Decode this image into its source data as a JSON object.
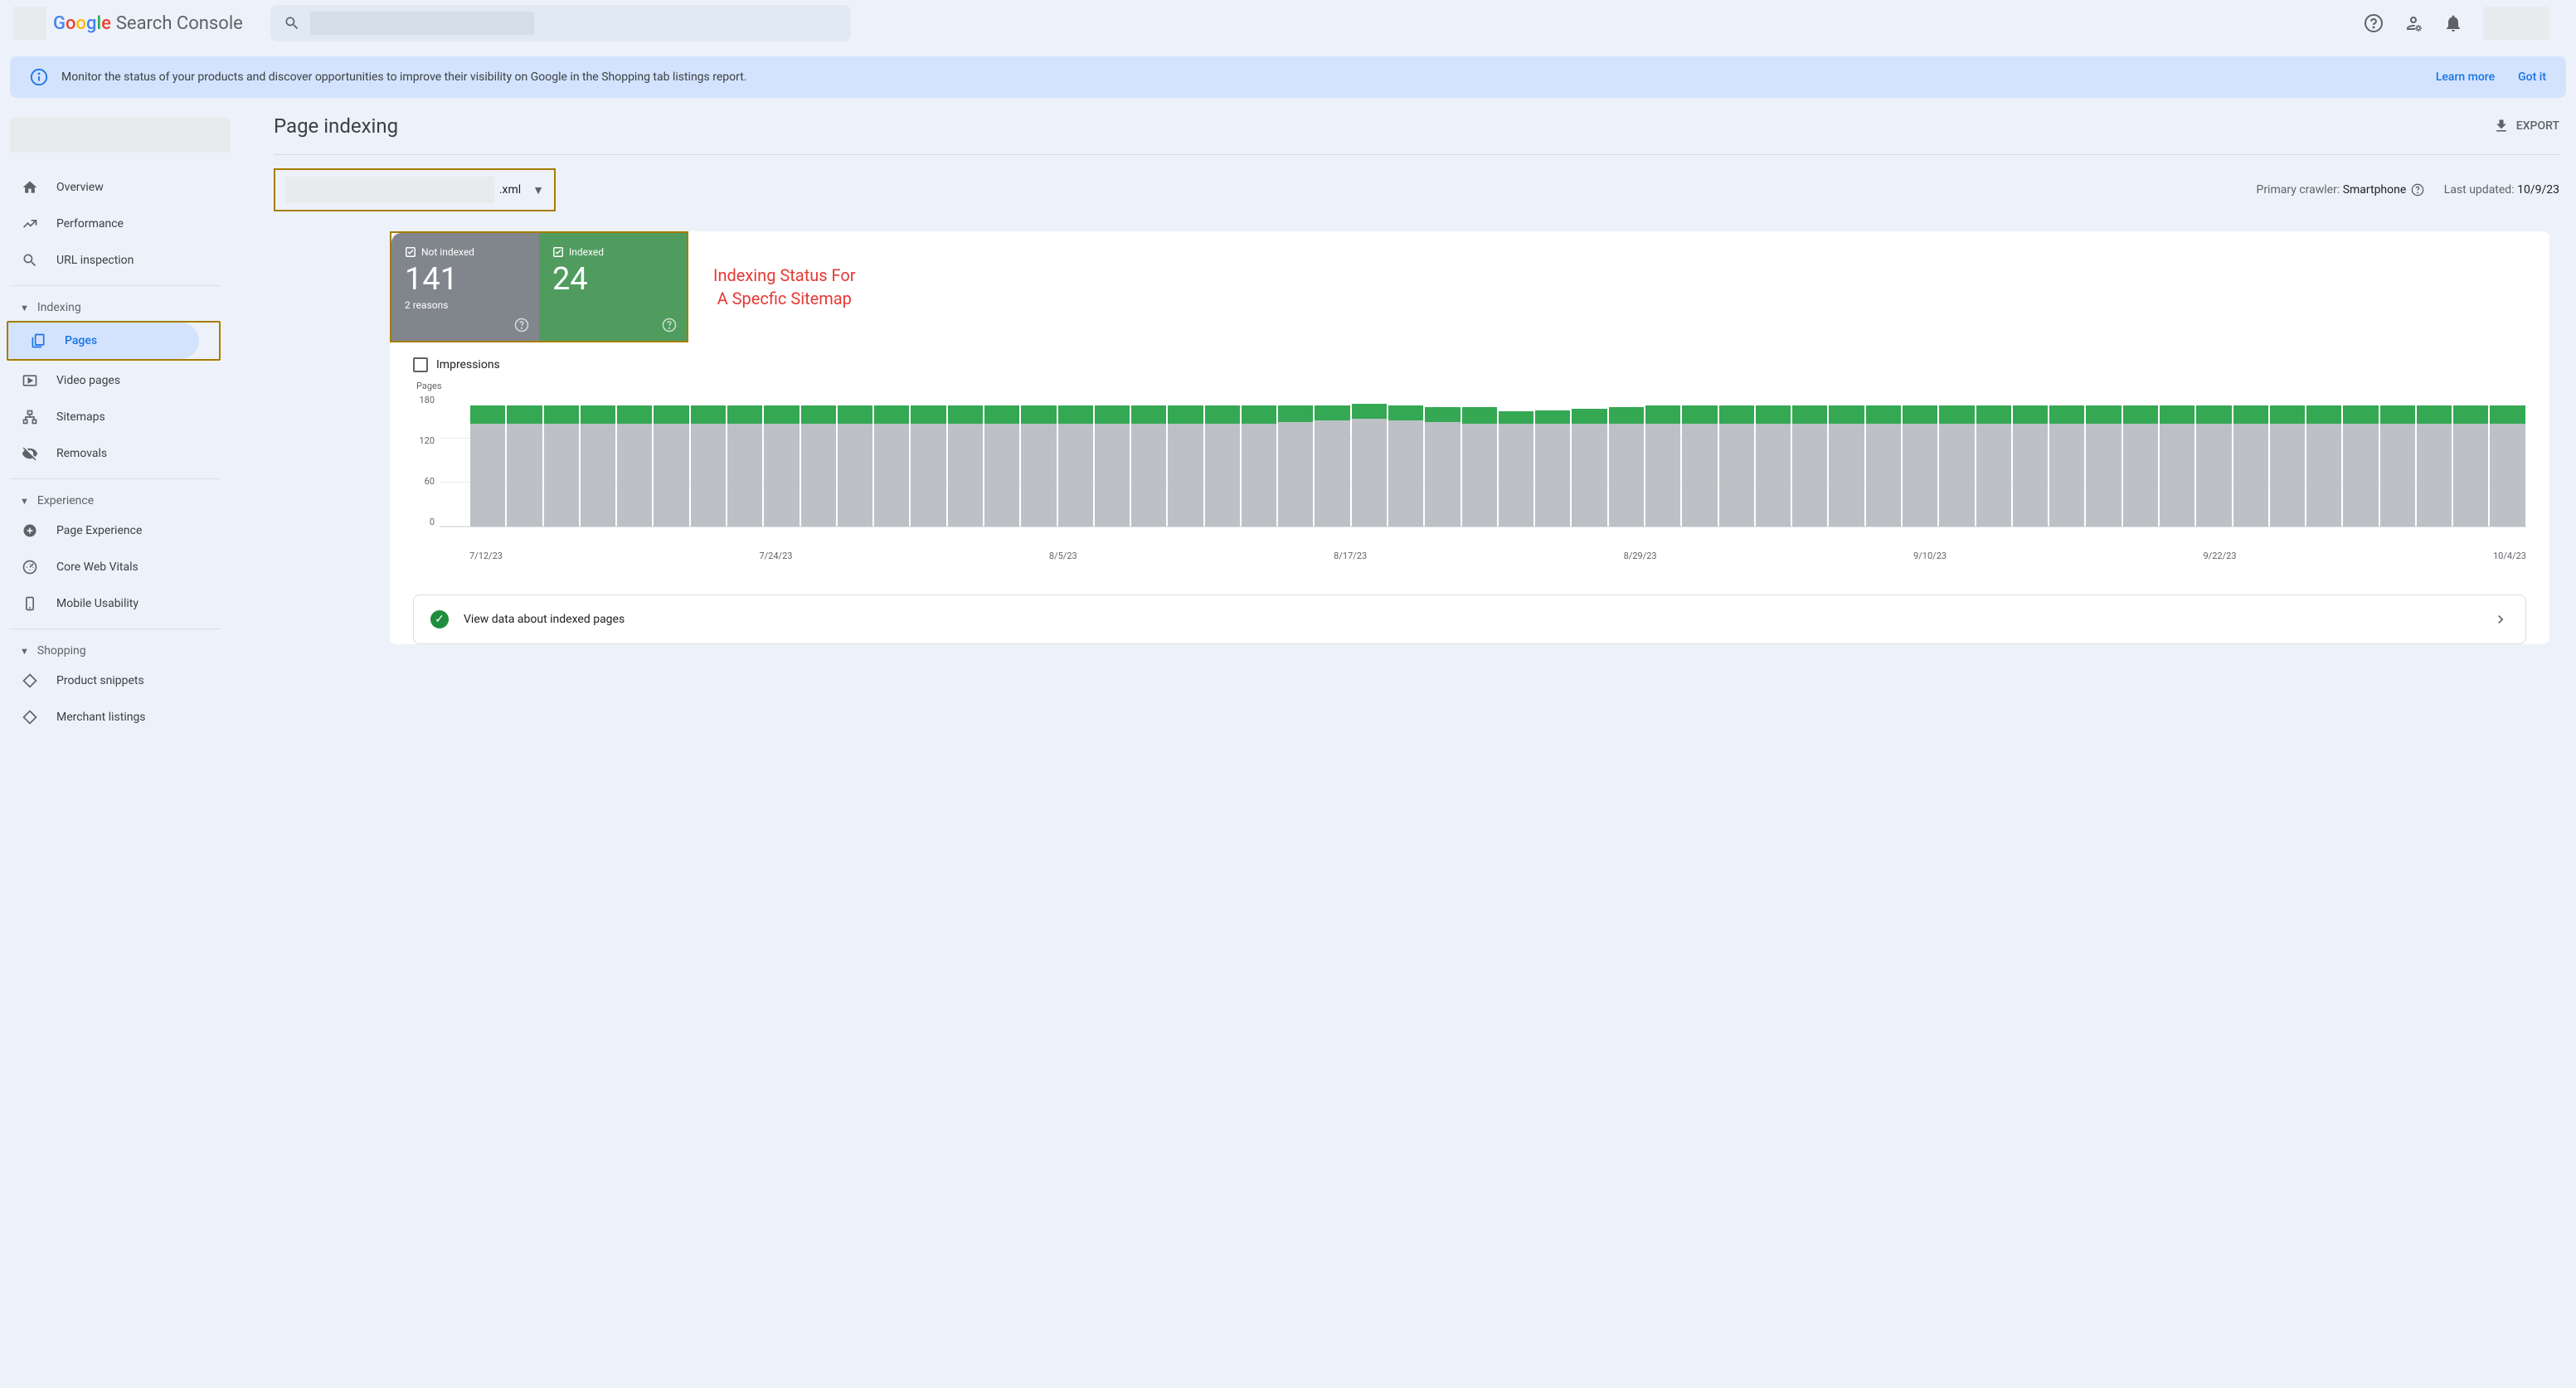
{
  "header": {
    "product": "Search Console",
    "googleLetters": [
      "G",
      "o",
      "o",
      "g",
      "l",
      "e"
    ]
  },
  "banner": {
    "icon": "info",
    "text": "Monitor the status of your products and discover opportunities to improve their visibility on Google in the Shopping tab listings report.",
    "learn": "Learn more",
    "gotit": "Got it"
  },
  "sidebar": {
    "overview": "Overview",
    "performance": "Performance",
    "urlinspection": "URL inspection",
    "indexing": "Indexing",
    "pages": "Pages",
    "videopages": "Video pages",
    "sitemaps": "Sitemaps",
    "removals": "Removals",
    "experience": "Experience",
    "pageexperience": "Page Experience",
    "cwv": "Core Web Vitals",
    "mobile": "Mobile Usability",
    "shopping": "Shopping",
    "snippets": "Product snippets",
    "merchant": "Merchant listings"
  },
  "page": {
    "title": "Page indexing",
    "export": "EXPORT",
    "sitemap_suffix": ".xml",
    "crawler_label": "Primary crawler:",
    "crawler_value": "Smartphone",
    "updated_label": "Last updated:",
    "updated_value": "10/9/23"
  },
  "stats": {
    "notindexed_label": "Not indexed",
    "notindexed_value": "141",
    "notindexed_sub": "2 reasons",
    "indexed_label": "Indexed",
    "indexed_value": "24"
  },
  "annotation": "Indexing Status For\nA Specfic Sitemap",
  "impressions_label": "Impressions",
  "chart_data": {
    "type": "bar",
    "ylabel": "Pages",
    "ylim": [
      0,
      180
    ],
    "yticks": [
      180,
      120,
      60,
      0
    ],
    "x_categories": [
      "7/12/23",
      "7/24/23",
      "8/5/23",
      "8/17/23",
      "8/29/23",
      "9/10/23",
      "9/22/23",
      "10/4/23"
    ],
    "series": [
      {
        "name": "Indexed",
        "color": "#34a853"
      },
      {
        "name": "Not indexed",
        "color": "#bdc1c6"
      }
    ],
    "bars": [
      {
        "grey": 140,
        "green": 24
      },
      {
        "grey": 140,
        "green": 24
      },
      {
        "grey": 140,
        "green": 24
      },
      {
        "grey": 140,
        "green": 24
      },
      {
        "grey": 140,
        "green": 24
      },
      {
        "grey": 140,
        "green": 24
      },
      {
        "grey": 140,
        "green": 24
      },
      {
        "grey": 140,
        "green": 24
      },
      {
        "grey": 140,
        "green": 24
      },
      {
        "grey": 140,
        "green": 24
      },
      {
        "grey": 140,
        "green": 24
      },
      {
        "grey": 140,
        "green": 24
      },
      {
        "grey": 140,
        "green": 24
      },
      {
        "grey": 140,
        "green": 24
      },
      {
        "grey": 140,
        "green": 24
      },
      {
        "grey": 140,
        "green": 24
      },
      {
        "grey": 140,
        "green": 24
      },
      {
        "grey": 140,
        "green": 24
      },
      {
        "grey": 140,
        "green": 24
      },
      {
        "grey": 140,
        "green": 24
      },
      {
        "grey": 140,
        "green": 24
      },
      {
        "grey": 140,
        "green": 24
      },
      {
        "grey": 142,
        "green": 22
      },
      {
        "grey": 144,
        "green": 20
      },
      {
        "grey": 146,
        "green": 20
      },
      {
        "grey": 144,
        "green": 20
      },
      {
        "grey": 142,
        "green": 20
      },
      {
        "grey": 140,
        "green": 22
      },
      {
        "grey": 140,
        "green": 16
      },
      {
        "grey": 140,
        "green": 18
      },
      {
        "grey": 140,
        "green": 20
      },
      {
        "grey": 140,
        "green": 22
      },
      {
        "grey": 140,
        "green": 24
      },
      {
        "grey": 140,
        "green": 24
      },
      {
        "grey": 140,
        "green": 24
      },
      {
        "grey": 140,
        "green": 24
      },
      {
        "grey": 140,
        "green": 24
      },
      {
        "grey": 140,
        "green": 24
      },
      {
        "grey": 140,
        "green": 24
      },
      {
        "grey": 140,
        "green": 24
      },
      {
        "grey": 140,
        "green": 24
      },
      {
        "grey": 140,
        "green": 24
      },
      {
        "grey": 140,
        "green": 24
      },
      {
        "grey": 140,
        "green": 24
      },
      {
        "grey": 140,
        "green": 24
      },
      {
        "grey": 140,
        "green": 24
      },
      {
        "grey": 140,
        "green": 24
      },
      {
        "grey": 140,
        "green": 24
      },
      {
        "grey": 140,
        "green": 24
      },
      {
        "grey": 140,
        "green": 24
      },
      {
        "grey": 140,
        "green": 24
      },
      {
        "grey": 140,
        "green": 24
      },
      {
        "grey": 140,
        "green": 24
      },
      {
        "grey": 140,
        "green": 24
      },
      {
        "grey": 140,
        "green": 24
      },
      {
        "grey": 140,
        "green": 24
      }
    ]
  },
  "view_link": "View data about indexed pages"
}
